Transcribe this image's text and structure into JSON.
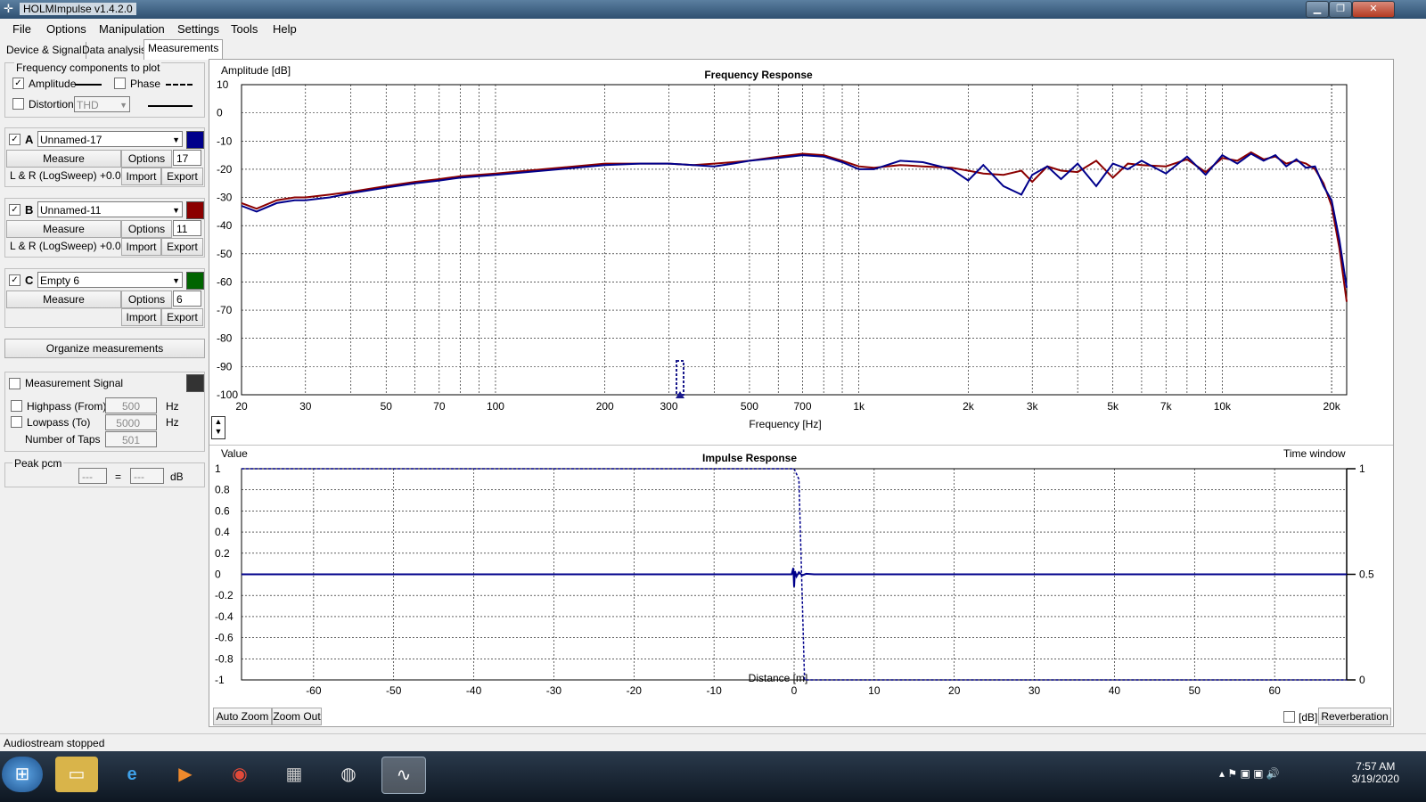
{
  "window": {
    "title": "HOLMImpulse  v1.4.2.0",
    "min_icon": "minimize-icon",
    "max_icon": "maximize-icon",
    "close_icon": "close-icon"
  },
  "menu": [
    "File",
    "Options",
    "Manipulation",
    "Settings",
    "Tools",
    "Help"
  ],
  "tabs": [
    "Device & Signal",
    "Data analysis",
    "Measurements"
  ],
  "active_tab": "Measurements",
  "freq_components": {
    "group_label": "Frequency components to plot",
    "amplitude_label": "Amplitude",
    "amplitude_checked": true,
    "phase_label": "Phase",
    "phase_checked": false,
    "distortion_label": "Distortion",
    "distortion_checked": false,
    "distortion_select": "THD"
  },
  "measurements": [
    {
      "letter": "A",
      "checked": true,
      "name": "Unnamed-17",
      "color": "#00008b",
      "measure": "Measure",
      "options": "Options",
      "number": "17",
      "info": "L & R (LogSweep) +0.0dB",
      "import": "Import",
      "export": "Export"
    },
    {
      "letter": "B",
      "checked": true,
      "name": "Unnamed-11",
      "color": "#8b0000",
      "measure": "Measure",
      "options": "Options",
      "number": "11",
      "info": "L & R (LogSweep) +0.0dB",
      "import": "Import",
      "export": "Export"
    },
    {
      "letter": "C",
      "checked": true,
      "name": "Empty 6",
      "color": "#006400",
      "measure": "Measure",
      "options": "Options",
      "number": "6",
      "info": "",
      "import": "Import",
      "export": "Export"
    }
  ],
  "organize_label": "Organize measurements",
  "signal": {
    "label": "Measurement Signal",
    "checked": false,
    "swatch_color": "#333333",
    "highpass_label": "Highpass (From)",
    "highpass_value": "500",
    "hz": "Hz",
    "lowpass_label": "Lowpass (To)",
    "lowpass_value": "5000",
    "taps_label": "Number of Taps",
    "taps_value": "501"
  },
  "peak": {
    "label": "Peak pcm",
    "left": "---",
    "eq": "=",
    "right": "---",
    "unit": "dB"
  },
  "freq_chart_text": {
    "title": "Frequency Response",
    "ylabel": "Amplitude [dB]",
    "xlabel": "Frequency [Hz]"
  },
  "impulse_chart_text": {
    "title": "Impulse Response",
    "ylabel": "Value",
    "xlabel": "Distance [m]",
    "right_label": "Time window"
  },
  "chart_data": [
    {
      "type": "line",
      "title": "Frequency Response",
      "xlabel": "Frequency [Hz]",
      "ylabel": "Amplitude [dB]",
      "xscale": "log",
      "xlim": [
        20,
        22000
      ],
      "ylim": [
        -100,
        10
      ],
      "xticks": [
        20,
        30,
        50,
        70,
        100,
        200,
        300,
        500,
        700,
        1000,
        2000,
        3000,
        5000,
        7000,
        10000,
        20000
      ],
      "xtick_labels": [
        "20",
        "30",
        "50",
        "70",
        "100",
        "200",
        "300",
        "500",
        "700",
        "1k",
        "2k",
        "3k",
        "5k",
        "7k",
        "10k",
        "20k"
      ],
      "yticks": [
        10,
        0,
        -10,
        -20,
        -30,
        -40,
        -50,
        -60,
        -70,
        -80,
        -90,
        -100
      ],
      "grid": true,
      "series": [
        {
          "color": "#8b0000",
          "x": [
            20,
            22,
            25,
            28,
            30,
            35,
            40,
            50,
            60,
            70,
            80,
            100,
            150,
            200,
            250,
            300,
            350,
            400,
            450,
            500,
            600,
            700,
            800,
            900,
            1000,
            1100,
            1300,
            1500,
            1800,
            2000,
            2200,
            2500,
            2800,
            3000,
            3300,
            3600,
            4000,
            4500,
            5000,
            5500,
            6000,
            7000,
            8000,
            9000,
            10000,
            11000,
            12000,
            13000,
            14000,
            15000,
            16000,
            17000,
            18000,
            19000,
            20000,
            21000,
            22000
          ],
          "y": [
            -32,
            -34,
            -31,
            -30,
            -30,
            -29,
            -28,
            -26,
            -24.5,
            -23.5,
            -22.5,
            -21.5,
            -19.5,
            -18,
            -18,
            -18,
            -18.5,
            -18,
            -17.5,
            -17,
            -15.5,
            -14.5,
            -15,
            -17,
            -19,
            -19.5,
            -18.5,
            -19,
            -19.5,
            -20.5,
            -21.5,
            -22,
            -20.5,
            -24.5,
            -19,
            -20.5,
            -21,
            -17,
            -23,
            -18,
            -18.5,
            -19,
            -16.5,
            -21,
            -16,
            -17,
            -14,
            -16.5,
            -15.5,
            -18,
            -17,
            -18,
            -20,
            -25,
            -33,
            -48,
            -67
          ]
        },
        {
          "color": "#00008b",
          "x": [
            20,
            22,
            25,
            28,
            30,
            35,
            40,
            50,
            60,
            70,
            80,
            100,
            150,
            200,
            250,
            300,
            350,
            400,
            450,
            500,
            600,
            700,
            800,
            900,
            1000,
            1100,
            1300,
            1500,
            1800,
            2000,
            2200,
            2500,
            2800,
            3000,
            3300,
            3600,
            4000,
            4500,
            5000,
            5500,
            6000,
            7000,
            8000,
            9000,
            10000,
            11000,
            12000,
            13000,
            14000,
            15000,
            16000,
            17000,
            18000,
            19000,
            20000,
            21000,
            22000
          ],
          "y": [
            -33,
            -35,
            -32,
            -31,
            -31,
            -30,
            -28.5,
            -26.5,
            -25,
            -24,
            -23,
            -22,
            -20,
            -18.5,
            -18,
            -18,
            -18.5,
            -19,
            -18,
            -17,
            -16,
            -15,
            -15.5,
            -17.5,
            -20,
            -20,
            -17,
            -17.5,
            -20,
            -24,
            -18.5,
            -26,
            -29,
            -22,
            -19,
            -23.5,
            -18,
            -26,
            -18,
            -20,
            -17,
            -21.5,
            -15.5,
            -22,
            -15,
            -18,
            -14.5,
            -17,
            -15,
            -19,
            -16.5,
            -19.5,
            -19,
            -26,
            -31,
            -45,
            -62
          ]
        }
      ]
    },
    {
      "type": "line",
      "title": "Impulse Response",
      "xlabel": "Distance [m]",
      "ylabel": "Value",
      "xlim": [
        -69,
        69
      ],
      "ylim": [
        -1,
        1
      ],
      "xticks": [
        -60,
        -50,
        -40,
        -30,
        -20,
        -10,
        0,
        10,
        20,
        30,
        40,
        50,
        60
      ],
      "yticks": [
        1,
        0.8,
        0.6,
        0.4,
        0.2,
        0,
        -0.2,
        -0.4,
        -0.6,
        -0.8,
        -1
      ],
      "ytick_labels": [
        "1",
        "0.8",
        "0.6",
        "0.4",
        "0.2",
        "0",
        "-0.2",
        "-0.4",
        "-0.6",
        "-0.8",
        "-1"
      ],
      "right_axis": {
        "label": "Time window",
        "ticks": [
          "1",
          "0.5",
          "0"
        ]
      },
      "grid": true,
      "series": [
        {
          "color": "#00008b",
          "x": [
            -69,
            -0.3,
            -0.1,
            0.0,
            0.1,
            0.3,
            0.6,
            1.0,
            1.5,
            2.5,
            69
          ],
          "y": [
            0,
            0,
            0.06,
            -0.12,
            0.03,
            -0.02,
            0.02,
            -0.01,
            0.005,
            0,
            0
          ]
        },
        {
          "color": "#00008b",
          "dashed": true,
          "name": "window",
          "x": [
            -69,
            0,
            0.6,
            1.3,
            69
          ],
          "y": [
            1,
            1,
            0.9,
            -1,
            -1
          ]
        }
      ]
    }
  ],
  "bottom_buttons": {
    "auto_zoom": "Auto Zoom",
    "zoom_out": "Zoom Out",
    "db_label": "[dB]",
    "reverberation": "Reverberation"
  },
  "status": "Audiostream stopped",
  "clock": {
    "time": "7:57 AM",
    "date": "3/19/2020"
  }
}
